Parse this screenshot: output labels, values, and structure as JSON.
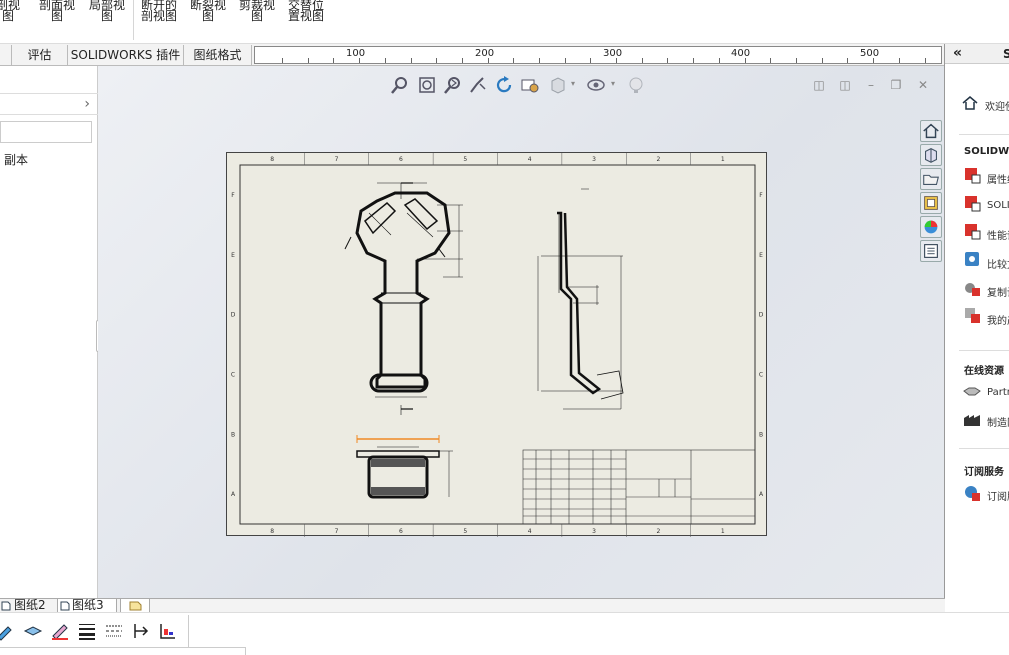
{
  "ribbon": {
    "buttons": [
      {
        "label": "剖视\n图"
      },
      {
        "label": "剖面视\n图"
      },
      {
        "label": "局部视\n图"
      },
      {
        "label": "断开的\n剖视图"
      },
      {
        "label": "断裂视\n图"
      },
      {
        "label": "剪裁视\n图"
      },
      {
        "label": "交替位\n置视图"
      }
    ]
  },
  "tabs": {
    "evaluate": "评估",
    "addins": "SOLIDWORKS 插件",
    "sheet_format": "图纸格式"
  },
  "ruler": {
    "marks": [
      "100",
      "200",
      "300",
      "400",
      "500"
    ]
  },
  "left_panel": {
    "copy_label": "副本"
  },
  "sheet_tabs": {
    "sheet2": "图纸2",
    "sheet3": "图纸3"
  },
  "task_pane": {
    "collapse": "«",
    "title": "S",
    "welcome": "欢迎使",
    "solidworks_head": "SOLIDWO",
    "tools": [
      {
        "label": "属性编"
      },
      {
        "label": "SOLID"
      },
      {
        "label": "性能评"
      },
      {
        "label": "比较文"
      },
      {
        "label": "复制设"
      },
      {
        "label": "我的产"
      }
    ],
    "online_head": "在线资源",
    "online": [
      {
        "label": "Partne"
      },
      {
        "label": "制造网"
      }
    ],
    "subscription_head": "订阅服务",
    "subscription": [
      {
        "label": "订阅服"
      }
    ]
  },
  "drawing": {
    "border_columns": [
      "8",
      "7",
      "6",
      "5",
      "4",
      "3",
      "2",
      "1"
    ],
    "border_rows": [
      "F",
      "E",
      "D",
      "C",
      "B",
      "A"
    ]
  },
  "colors": {
    "sheet_bg": "#ecebe2",
    "accent_orange": "#f08a24",
    "viewport_bg": "#e4e7ec"
  }
}
